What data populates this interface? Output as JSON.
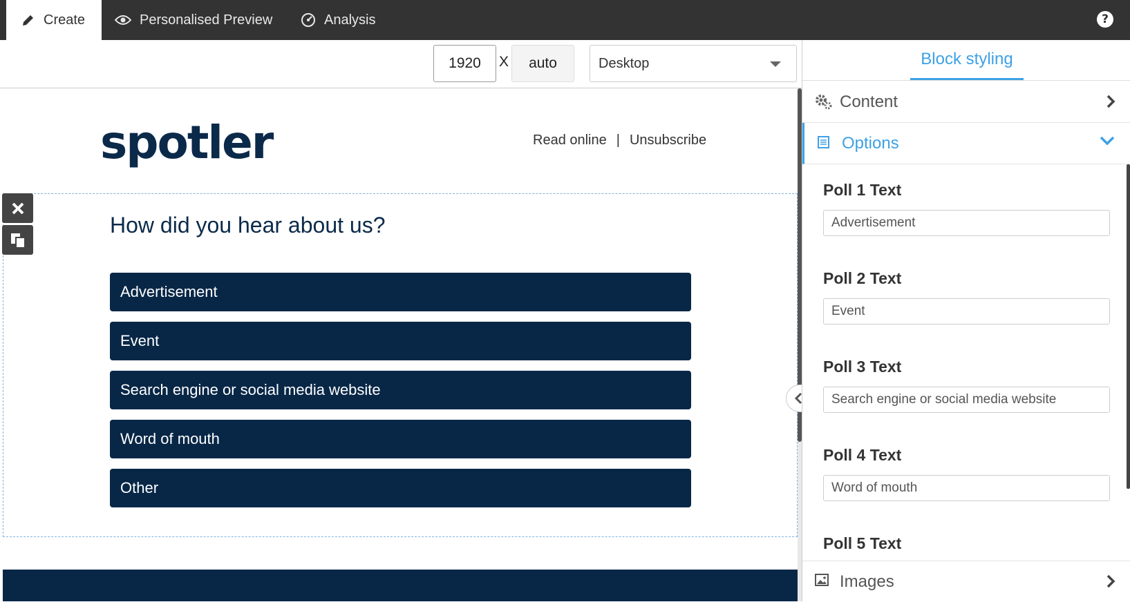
{
  "tabs": [
    {
      "label": "Create",
      "icon": "pencil-icon",
      "active": true
    },
    {
      "label": "Personalised Preview",
      "icon": "eye-icon",
      "active": false
    },
    {
      "label": "Analysis",
      "icon": "gauge-icon",
      "active": false
    }
  ],
  "help": {
    "label": "?"
  },
  "viewport": {
    "width": "1920",
    "separator": "X",
    "height": "auto",
    "device": "Desktop"
  },
  "email": {
    "logo": "spotler",
    "links": {
      "read_online": "Read online",
      "divider": "|",
      "unsubscribe": "Unsubscribe"
    },
    "poll": {
      "question": "How did you hear about us?",
      "options": [
        "Advertisement",
        "Event",
        "Search engine or social media website",
        "Word of mouth",
        "Other"
      ]
    }
  },
  "panel": {
    "tab": "Block styling",
    "sections": {
      "content": "Content",
      "options": "Options",
      "images": "Images"
    },
    "fields": [
      {
        "label": "Poll 1 Text",
        "value": "Advertisement"
      },
      {
        "label": "Poll 2 Text",
        "value": "Event"
      },
      {
        "label": "Poll 3 Text",
        "value": "Search engine or social media website"
      },
      {
        "label": "Poll 4 Text",
        "value": "Word of mouth"
      },
      {
        "label": "Poll 5 Text",
        "value": ""
      }
    ]
  },
  "colors": {
    "accent": "#3ea1e5",
    "brand_navy": "#082747",
    "topbar": "#333333"
  }
}
